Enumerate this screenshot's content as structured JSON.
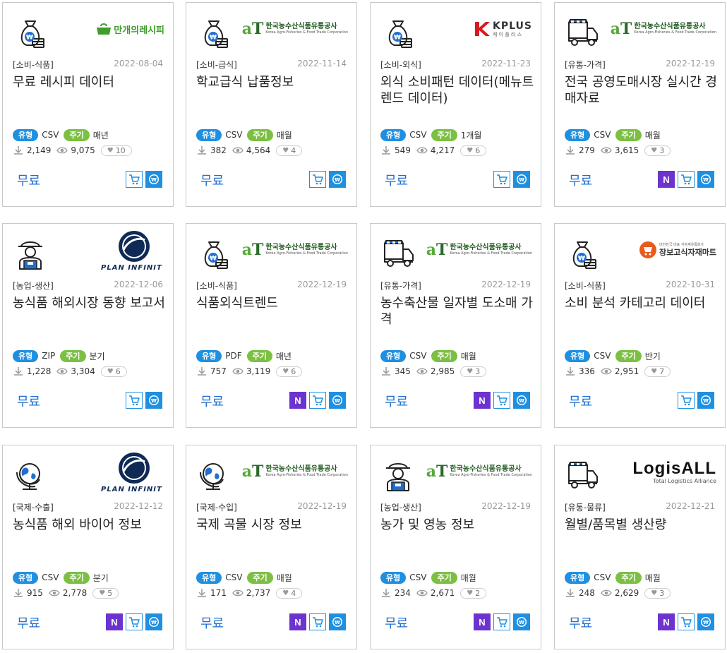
{
  "colors": {
    "type_pill": "#1f8fe0",
    "cycle_pill": "#7cc043",
    "price": "#1f6fd0",
    "n_button": "#6c33cf"
  },
  "labels": {
    "type": "유형",
    "cycle": "주기",
    "n_button": "N"
  },
  "cards": [
    {
      "icon": "money-bag-icon",
      "provider": {
        "kind": "text-logo",
        "text": "만개의레시피",
        "color": "#3f9d2b"
      },
      "category": "[소비-식품]",
      "date": "2022-08-04",
      "title": "무료 레시피 데이터",
      "file_type": "CSV",
      "cycle": "매년",
      "downloads": "2,149",
      "views": "9,075",
      "likes": "10",
      "price": "무료",
      "n_button": false
    },
    {
      "icon": "money-bag-icon",
      "provider": {
        "kind": "at-logo",
        "name": "한국농수산식품유통공사",
        "sub": "Korea Agro-Fisheries & Food Trade Corporation"
      },
      "category": "[소비-급식]",
      "date": "2022-11-14",
      "title": "학교급식 납품정보",
      "file_type": "CSV",
      "cycle": "매월",
      "downloads": "382",
      "views": "4,564",
      "likes": "4",
      "price": "무료",
      "n_button": false
    },
    {
      "icon": "money-bag-icon",
      "provider": {
        "kind": "kplus-logo",
        "text": "KPLUS",
        "sub": "케 이 플 러 스"
      },
      "category": "[소비-외식]",
      "date": "2022-11-23",
      "title": "외식 소비패턴 데이터(메뉴트렌드 데이터)",
      "file_type": "CSV",
      "cycle": "1개월",
      "downloads": "549",
      "views": "4,217",
      "likes": "6",
      "price": "무료",
      "n_button": false
    },
    {
      "icon": "truck-icon",
      "provider": {
        "kind": "at-logo",
        "name": "한국농수산식품유통공사",
        "sub": "Korea Agro-Fisheries & Food Trade Corporation"
      },
      "category": "[유통-가격]",
      "date": "2022-12-19",
      "title": "전국 공영도매시장 실시간 경매자료",
      "file_type": "CSV",
      "cycle": "매월",
      "downloads": "279",
      "views": "3,615",
      "likes": "3",
      "price": "무료",
      "n_button": true
    },
    {
      "icon": "farmer-icon",
      "provider": {
        "kind": "plan-logo",
        "text": "PLAN INFINIT"
      },
      "category": "[농업-생산]",
      "date": "2022-12-06",
      "title": "농식품 해외시장 동향 보고서",
      "file_type": "ZIP",
      "cycle": "분기",
      "downloads": "1,228",
      "views": "3,304",
      "likes": "6",
      "price": "무료",
      "n_button": false
    },
    {
      "icon": "money-bag-icon",
      "provider": {
        "kind": "at-logo",
        "name": "한국농수산식품유통공사",
        "sub": "Korea Agro-Fisheries & Food Trade Corporation"
      },
      "category": "[소비-식품]",
      "date": "2022-12-19",
      "title": "식품외식트렌드",
      "file_type": "PDF",
      "cycle": "매년",
      "downloads": "757",
      "views": "3,119",
      "likes": "6",
      "price": "무료",
      "n_button": true
    },
    {
      "icon": "truck-icon",
      "provider": {
        "kind": "at-logo",
        "name": "한국농수산식품유통공사",
        "sub": "Korea Agro-Fisheries & Food Trade Corporation"
      },
      "category": "[유통-가격]",
      "date": "2022-12-19",
      "title": "농수축산물 일자별 도소매 가격",
      "file_type": "CSV",
      "cycle": "매월",
      "downloads": "345",
      "views": "2,985",
      "likes": "3",
      "price": "무료",
      "n_button": true
    },
    {
      "icon": "money-bag-icon",
      "provider": {
        "kind": "jangbogo-logo",
        "text": "장보고식자재마트",
        "sub": "대한민국 대표 식자재유통회사"
      },
      "category": "[소비-식품]",
      "date": "2022-10-31",
      "title": "소비 분석 카테고리 데이터",
      "file_type": "CSV",
      "cycle": "반기",
      "downloads": "336",
      "views": "2,951",
      "likes": "7",
      "price": "무료",
      "n_button": false
    },
    {
      "icon": "globe-icon",
      "provider": {
        "kind": "plan-logo",
        "text": "PLAN INFINIT"
      },
      "category": "[국제-수출]",
      "date": "2022-12-12",
      "title": "농식품 해외 바이어 정보",
      "file_type": "CSV",
      "cycle": "분기",
      "downloads": "915",
      "views": "2,778",
      "likes": "5",
      "price": "무료",
      "n_button": true
    },
    {
      "icon": "globe-icon",
      "provider": {
        "kind": "at-logo",
        "name": "한국농수산식품유통공사",
        "sub": "Korea Agro-Fisheries & Food Trade Corporation"
      },
      "category": "[국제-수입]",
      "date": "2022-12-19",
      "title": "국제 곡물 시장 정보",
      "file_type": "CSV",
      "cycle": "매월",
      "downloads": "171",
      "views": "2,737",
      "likes": "4",
      "price": "무료",
      "n_button": true
    },
    {
      "icon": "farmer-icon",
      "provider": {
        "kind": "at-logo",
        "name": "한국농수산식품유통공사",
        "sub": "Korea Agro-Fisheries & Food Trade Corporation"
      },
      "category": "[농업-생산]",
      "date": "2022-12-19",
      "title": "농가 및 영농 정보",
      "file_type": "CSV",
      "cycle": "매월",
      "downloads": "234",
      "views": "2,671",
      "likes": "2",
      "price": "무료",
      "n_button": true
    },
    {
      "icon": "truck-icon",
      "provider": {
        "kind": "logisall-logo",
        "text": "LogisALL",
        "sub": "Total Logistics Alliance"
      },
      "category": "[유통-물류]",
      "date": "2022-12-21",
      "title": "월별/품목별 생산량",
      "file_type": "CSV",
      "cycle": "매월",
      "downloads": "248",
      "views": "2,629",
      "likes": "3",
      "price": "무료",
      "n_button": true
    }
  ]
}
